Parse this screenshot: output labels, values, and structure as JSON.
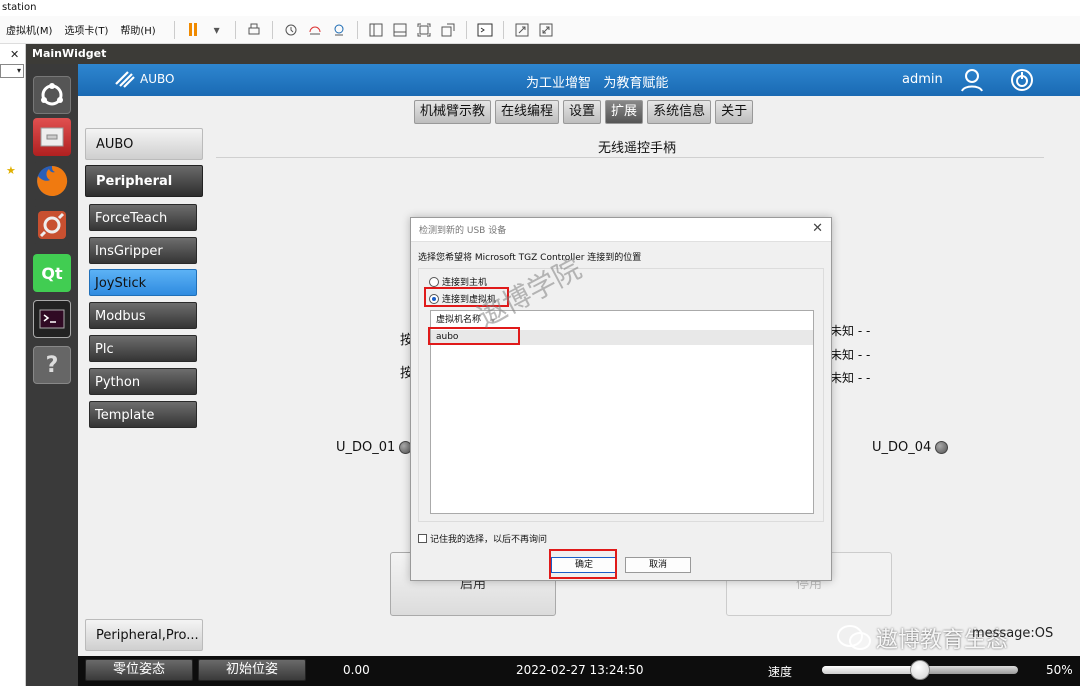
{
  "host": {
    "title": "station",
    "menus": [
      "虚拟机(M)",
      "选项卡(T)",
      "帮助(H)"
    ]
  },
  "guest": {
    "window_title": "MainWidget"
  },
  "app": {
    "brand": "AUBO",
    "slogan": "为工业增智   为教育赋能",
    "user": "admin",
    "tabs": [
      {
        "label": "机械臂示教",
        "active": false
      },
      {
        "label": "在线编程",
        "active": false
      },
      {
        "label": "设置",
        "active": false
      },
      {
        "label": "扩展",
        "active": true
      },
      {
        "label": "系统信息",
        "active": false
      },
      {
        "label": "关于",
        "active": false
      }
    ],
    "page_title": "无线遥控手柄",
    "sidebar": {
      "categories": [
        "AUBO",
        "Peripheral"
      ],
      "items": [
        {
          "label": "ForceTeach",
          "active": false
        },
        {
          "label": "InsGripper",
          "active": false
        },
        {
          "label": "JoyStick",
          "active": true
        },
        {
          "label": "Modbus",
          "active": false
        },
        {
          "label": "Plc",
          "active": false
        },
        {
          "label": "Python",
          "active": false
        },
        {
          "label": "Template",
          "active": false
        }
      ],
      "bottom_label": "Peripheral,Pro..."
    },
    "panel": {
      "partial_left": [
        "按",
        "按"
      ],
      "partial_right": [
        "未知 - -",
        "未知 - -",
        "未知 - -"
      ],
      "io_left": "U_DO_01",
      "io_right": "U_DO_04",
      "btn_enable": "启用",
      "btn_disable": "停用"
    },
    "status_bar": {
      "btn_zero": "零位姿态",
      "btn_init": "初始位姿",
      "value": "0.00",
      "datetime": "2022-02-27 13:24:50",
      "speed_label": "速度",
      "speed_percent": "50%",
      "speed_fraction": 0.5
    }
  },
  "dialog": {
    "title": "检测到新的 USB 设备",
    "instruction": "选择您希望将 Microsoft TGZ Controller 连接到的位置",
    "options": [
      {
        "label": "连接到主机",
        "checked": false
      },
      {
        "label": "连接到虚拟机",
        "checked": true
      }
    ],
    "list_header": "虚拟机名称",
    "list_rows": [
      "aubo"
    ],
    "remember": "记住我的选择，以后不再询问",
    "ok": "确定",
    "cancel": "取消"
  },
  "watermarks": {
    "center": "遨博学院",
    "corner": "遨博教育生态",
    "corner_partial": "message:OS"
  }
}
